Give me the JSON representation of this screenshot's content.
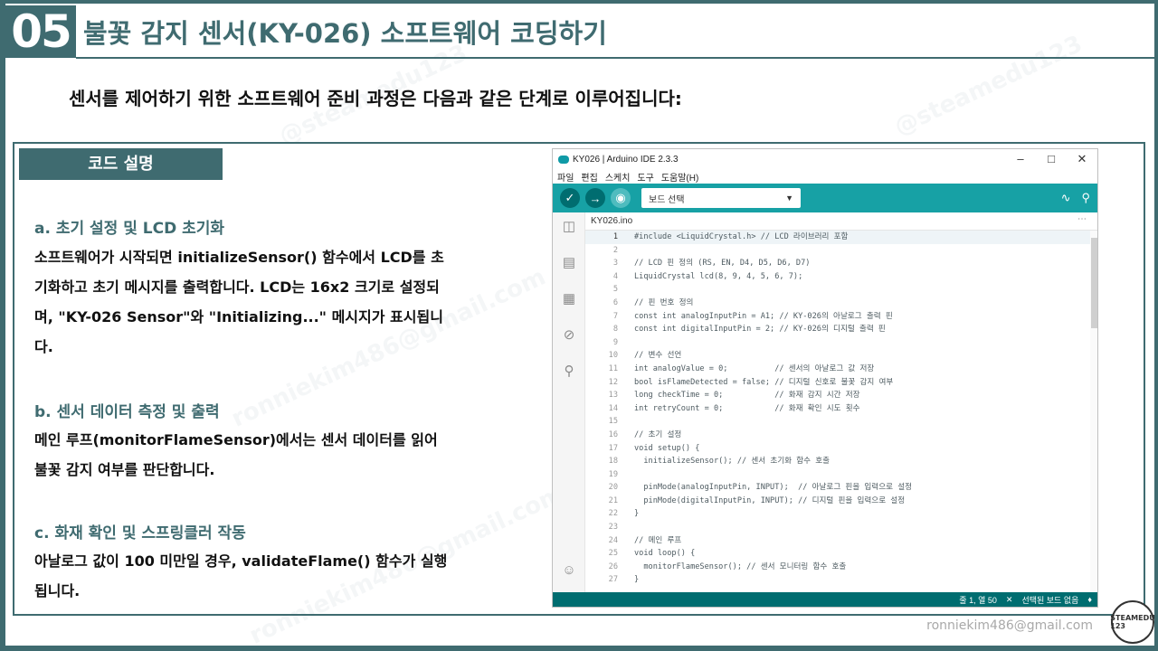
{
  "title": {
    "number": "05",
    "text": "불꽃 감지 센서(KY-026) 소프트웨어 코딩하기"
  },
  "subtitle": "센서를 제어하기 위한 소프트웨어 준비 과정은 다음과 같은 단계로 이루어집니다:",
  "code_tag": "코드 설명",
  "sections": [
    {
      "head": "a. 초기 설정 및 LCD 초기화",
      "body": "소프트웨어가 시작되면 initializeSensor() 함수에서 LCD를 초기화하고 초기 메시지를 출력합니다. LCD는 16x2 크기로 설정되며, \"KY-026 Sensor\"와 \"Initializing...\" 메시지가 표시됩니다."
    },
    {
      "head": "b. 센서 데이터 측정 및 출력",
      "body": "메인 루프(monitorFlameSensor)에서는 센서 데이터를 읽어 불꽃 감지 여부를 판단합니다."
    },
    {
      "head": "c. 화재 확인 및 스프링클러 작동",
      "body": "아날로그 값이 100 미만일 경우, validateFlame() 함수가 실행됩니다."
    }
  ],
  "footer": {
    "email": "ronniekim486@gmail.com",
    "logo_text": "STEAMEDU 123"
  },
  "watermarks": [
    "@steamedu123",
    "ronniekim486@gmail.com",
    "STEAMEDU 123"
  ],
  "ide": {
    "window_title": "KY026 | Arduino IDE 2.3.3",
    "menu": [
      "파일",
      "편집",
      "스케치",
      "도구",
      "도움말(H)"
    ],
    "board_placeholder": "보드 선택",
    "tab": "KY026.ino",
    "status": {
      "position": "줄 1, 열 50",
      "board": "선택된 보드 없음"
    },
    "code_lines": [
      "#include <LiquidCrystal.h> // LCD 라이브러리 포함",
      "",
      "// LCD 핀 정의 (RS, EN, D4, D5, D6, D7)",
      "LiquidCrystal lcd(8, 9, 4, 5, 6, 7);",
      "",
      "// 핀 번호 정의",
      "const int analogInputPin = A1; // KY-026의 아날로그 출력 핀",
      "const int digitalInputPin = 2; // KY-026의 디지털 출력 핀",
      "",
      "// 변수 선언",
      "int analogValue = 0;          // 센서의 아날로그 값 저장",
      "bool isFlameDetected = false; // 디지털 신호로 불꽃 감지 여부",
      "long checkTime = 0;           // 화재 감지 시간 저장",
      "int retryCount = 0;           // 화재 확인 시도 횟수",
      "",
      "// 초기 설정",
      "void setup() {",
      "  initializeSensor(); // 센서 초기화 함수 호출",
      "",
      "  pinMode(analogInputPin, INPUT);  // 아날로그 핀을 입력으로 설정",
      "  pinMode(digitalInputPin, INPUT); // 디지털 핀을 입력으로 설정",
      "}",
      "",
      "// 메인 루프",
      "void loop() {",
      "  monitorFlameSensor(); // 센서 모니터링 함수 호출",
      "}"
    ]
  }
}
